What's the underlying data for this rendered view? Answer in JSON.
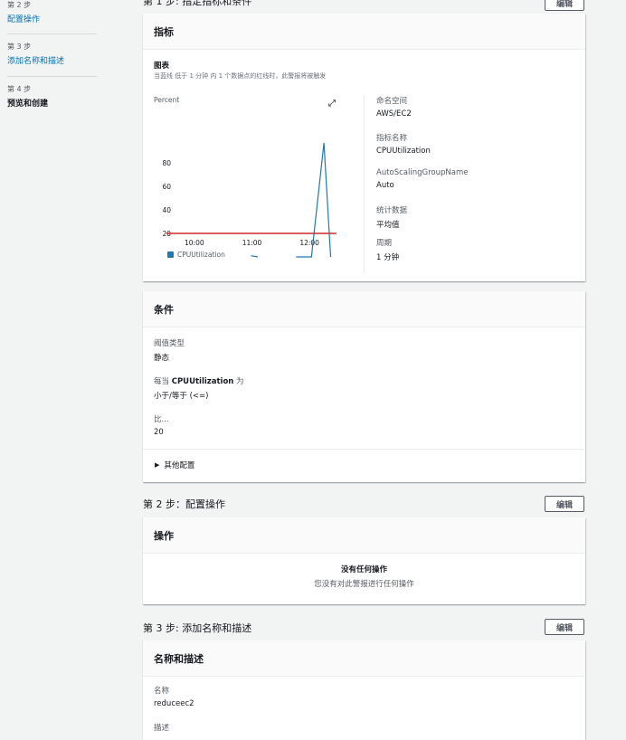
{
  "nav": {
    "steps": [
      {
        "num": "第 2 步",
        "name": "配置操作"
      },
      {
        "num": "第 3 步",
        "name": "添加名称和描述"
      },
      {
        "num": "第 4 步",
        "name": "预览和创建"
      }
    ]
  },
  "step1": {
    "title": "第 1 步: 指定指标和条件",
    "edit": "编辑"
  },
  "metric_card": {
    "header": "指标",
    "graph_title": "图表",
    "graph_desc": "当蓝线 低于 1 分钟 内 1 个数据点的红线时，此警报将被触发",
    "y_unit": "Percent",
    "details": [
      {
        "label": "命名空间",
        "value": "AWS/EC2"
      },
      {
        "label": "指标名称",
        "value": "CPUUtilization"
      },
      {
        "label": "AutoScalingGroupName",
        "value": "Auto"
      },
      {
        "label": "统计数据",
        "value": "平均值"
      },
      {
        "label": "周期",
        "value": "1 分钟"
      }
    ]
  },
  "chart_data": {
    "type": "line",
    "ylabel": "Percent",
    "y_ticks": [
      20,
      40,
      60,
      80
    ],
    "x_ticks": [
      "10:00",
      "11:00",
      "12:00"
    ],
    "x_range_minutes": [
      0,
      180
    ],
    "ylim": [
      0,
      100
    ],
    "series": [
      {
        "name": "CPUUtilization",
        "color": "#1f77b4",
        "segments": [
          [
            [
              89,
              1
            ],
            [
              96,
              0
            ]
          ],
          [
            [
              136,
              0
            ],
            [
              152,
              0
            ],
            [
              165,
              97
            ],
            [
              172,
              0
            ]
          ]
        ]
      }
    ],
    "threshold": {
      "value": 20,
      "color": "#d62728"
    },
    "legend": "bottom-left",
    "grid": false
  },
  "conditions_card": {
    "header": "条件",
    "threshold_type_label": "阈值类型",
    "threshold_type": "静态",
    "whenever_prefix": "每当 ",
    "whenever_metric": "CPUUtilization",
    "whenever_suffix": " 为",
    "operator": "小于/等于 (<=)",
    "than_label": "比...",
    "than_value": "20",
    "additional_config": "其他配置"
  },
  "step2": {
    "title": "第 2 步：配置操作",
    "edit": "编辑",
    "card_header": "操作",
    "empty_title": "没有任何操作",
    "empty_desc": "您没有对此警报进行任何操作"
  },
  "step3": {
    "title": "第 3 步: 添加名称和描述",
    "edit": "编辑",
    "card_header": "名称和描述",
    "name_label": "名称",
    "name_value": "reduceec2",
    "desc_label": "描述"
  }
}
